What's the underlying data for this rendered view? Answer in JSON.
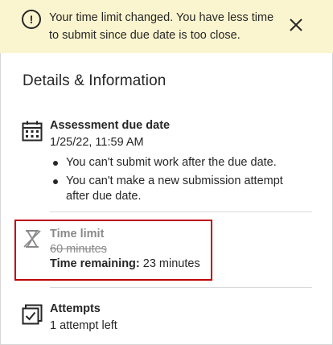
{
  "banner": {
    "message": "Your time limit changed. You have less time to submit since due date is too close.",
    "icon": "exclamation-circle-icon",
    "close_icon": "close-icon",
    "background": "#fbf5cf"
  },
  "details": {
    "title": "Details & Information",
    "due": {
      "icon": "calendar-icon",
      "label": "Assessment due date",
      "value": "1/25/22, 11:59 AM",
      "notes": [
        "You can't submit work after the due date.",
        "You can't make a new submission attempt after due date."
      ]
    },
    "time_limit": {
      "icon": "hourglass-disabled-icon",
      "label": "Time limit",
      "old_value": "60 minutes",
      "remaining_label": "Time remaining:",
      "remaining_value": "23 minutes",
      "highlight_color": "#c00000"
    },
    "attempts": {
      "icon": "attempts-checkbox-icon",
      "label": "Attempts",
      "value": "1 attempt left"
    }
  }
}
